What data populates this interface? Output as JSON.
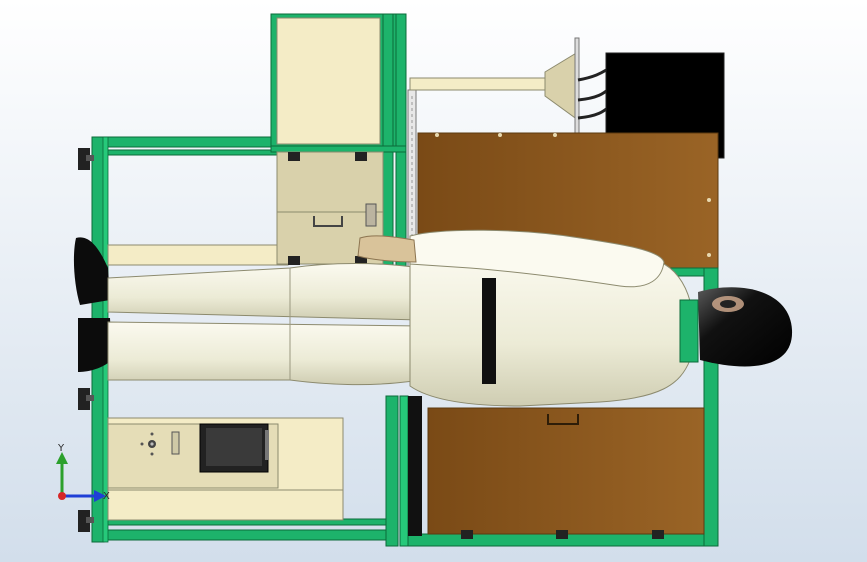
{
  "viewport": {
    "background_top": "#ffffff",
    "background_bottom": "#c9d6e6"
  },
  "colors": {
    "frame_green": "#1db36b",
    "frame_green_dark": "#0b6b3a",
    "panel_cream": "#f4ecc6",
    "panel_tan": "#d9d1ab",
    "box_brown": "#8e5a1f",
    "box_brown_dark": "#5c3a10",
    "suit_white": "#f1efde",
    "helmet_black": "#101010",
    "monitor_black": "#000000"
  },
  "triad": {
    "y_label": "Y",
    "x_label": "X",
    "y_color": "#2ca02c",
    "x_color": "#1f3fd6",
    "z_color": "#d62728"
  },
  "icons": {
    "triad": "coordinate-triad-icon"
  }
}
